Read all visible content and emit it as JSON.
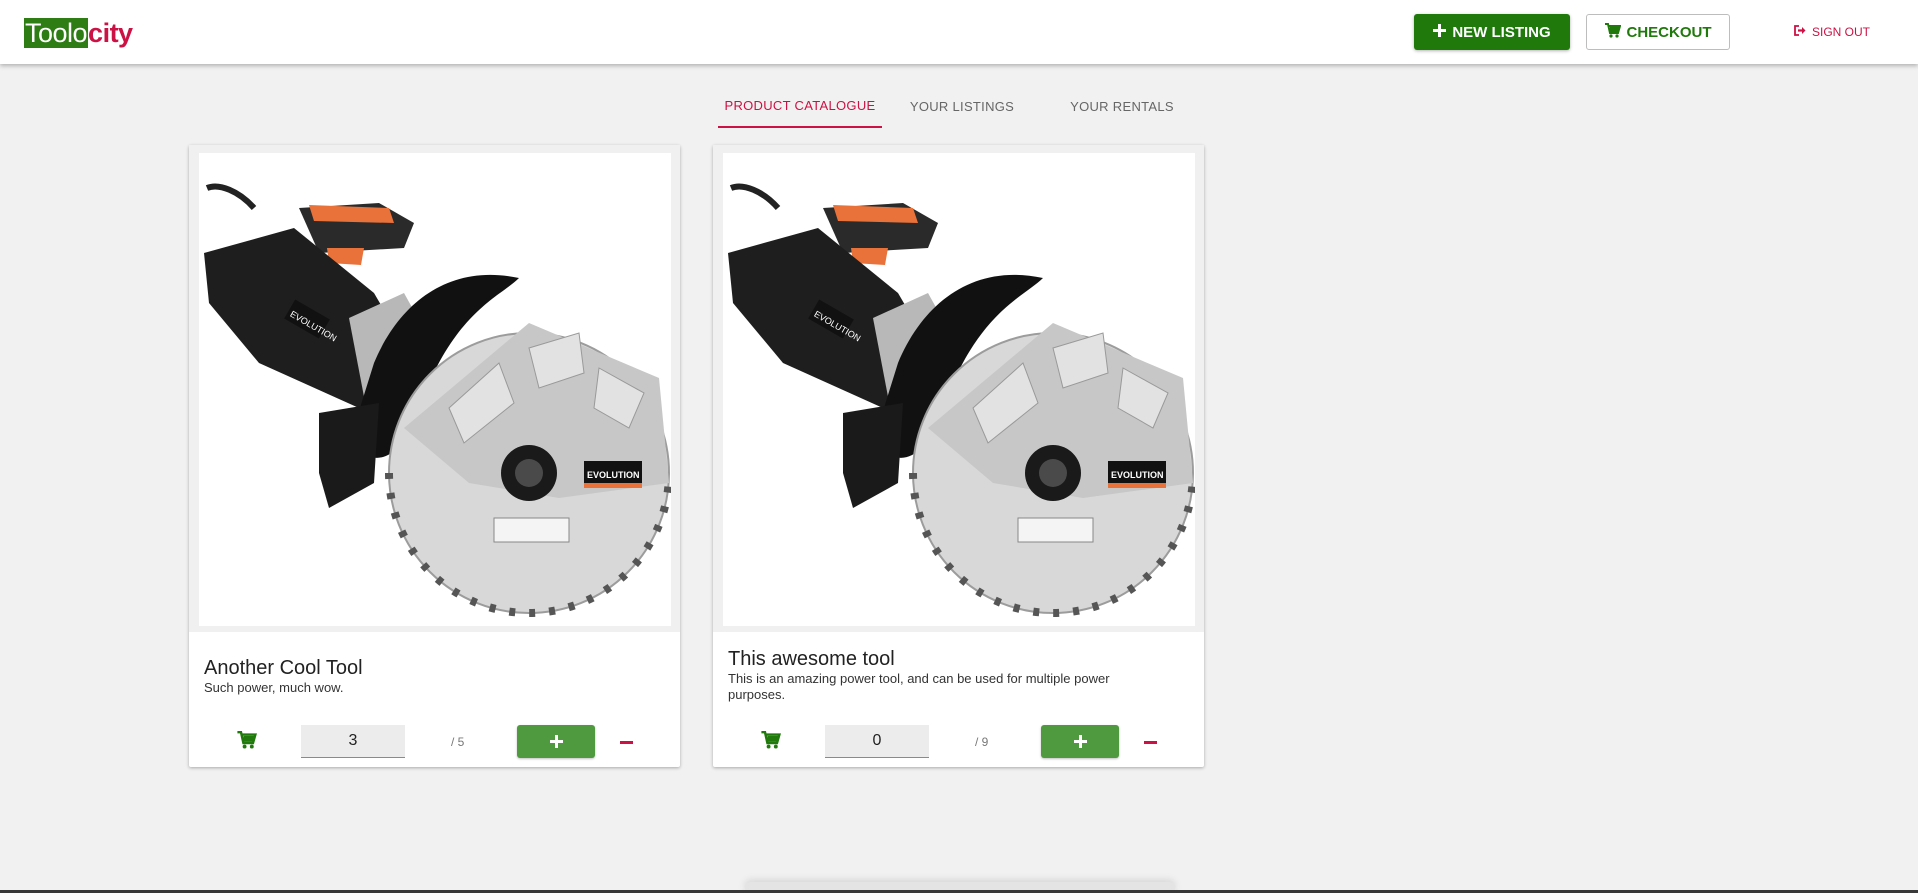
{
  "app": {
    "logo_part1": "Toolo",
    "logo_part2": "city"
  },
  "header": {
    "new_listing_label": "NEW LISTING",
    "checkout_label": "CHECKOUT",
    "signout_label": "SIGN OUT"
  },
  "tabs": [
    {
      "label": "PRODUCT CATALOGUE",
      "active": true
    },
    {
      "label": "YOUR LISTINGS",
      "active": false
    },
    {
      "label": "YOUR RENTALS",
      "active": false
    }
  ],
  "products": [
    {
      "title": "Another Cool Tool",
      "description": "Such power, much wow.",
      "quantity": "3",
      "max": "/ 5",
      "image_brand": "EVOLUTION"
    },
    {
      "title": "This awesome tool",
      "description": "This is an amazing power tool, and can be used for multiple power purposes.",
      "quantity": "0",
      "max": "/ 9",
      "image_brand": "EVOLUTION"
    }
  ],
  "colors": {
    "primary_green": "#1f7a0b",
    "accent_red": "#cc1144",
    "button_green": "#4f9a3e"
  }
}
